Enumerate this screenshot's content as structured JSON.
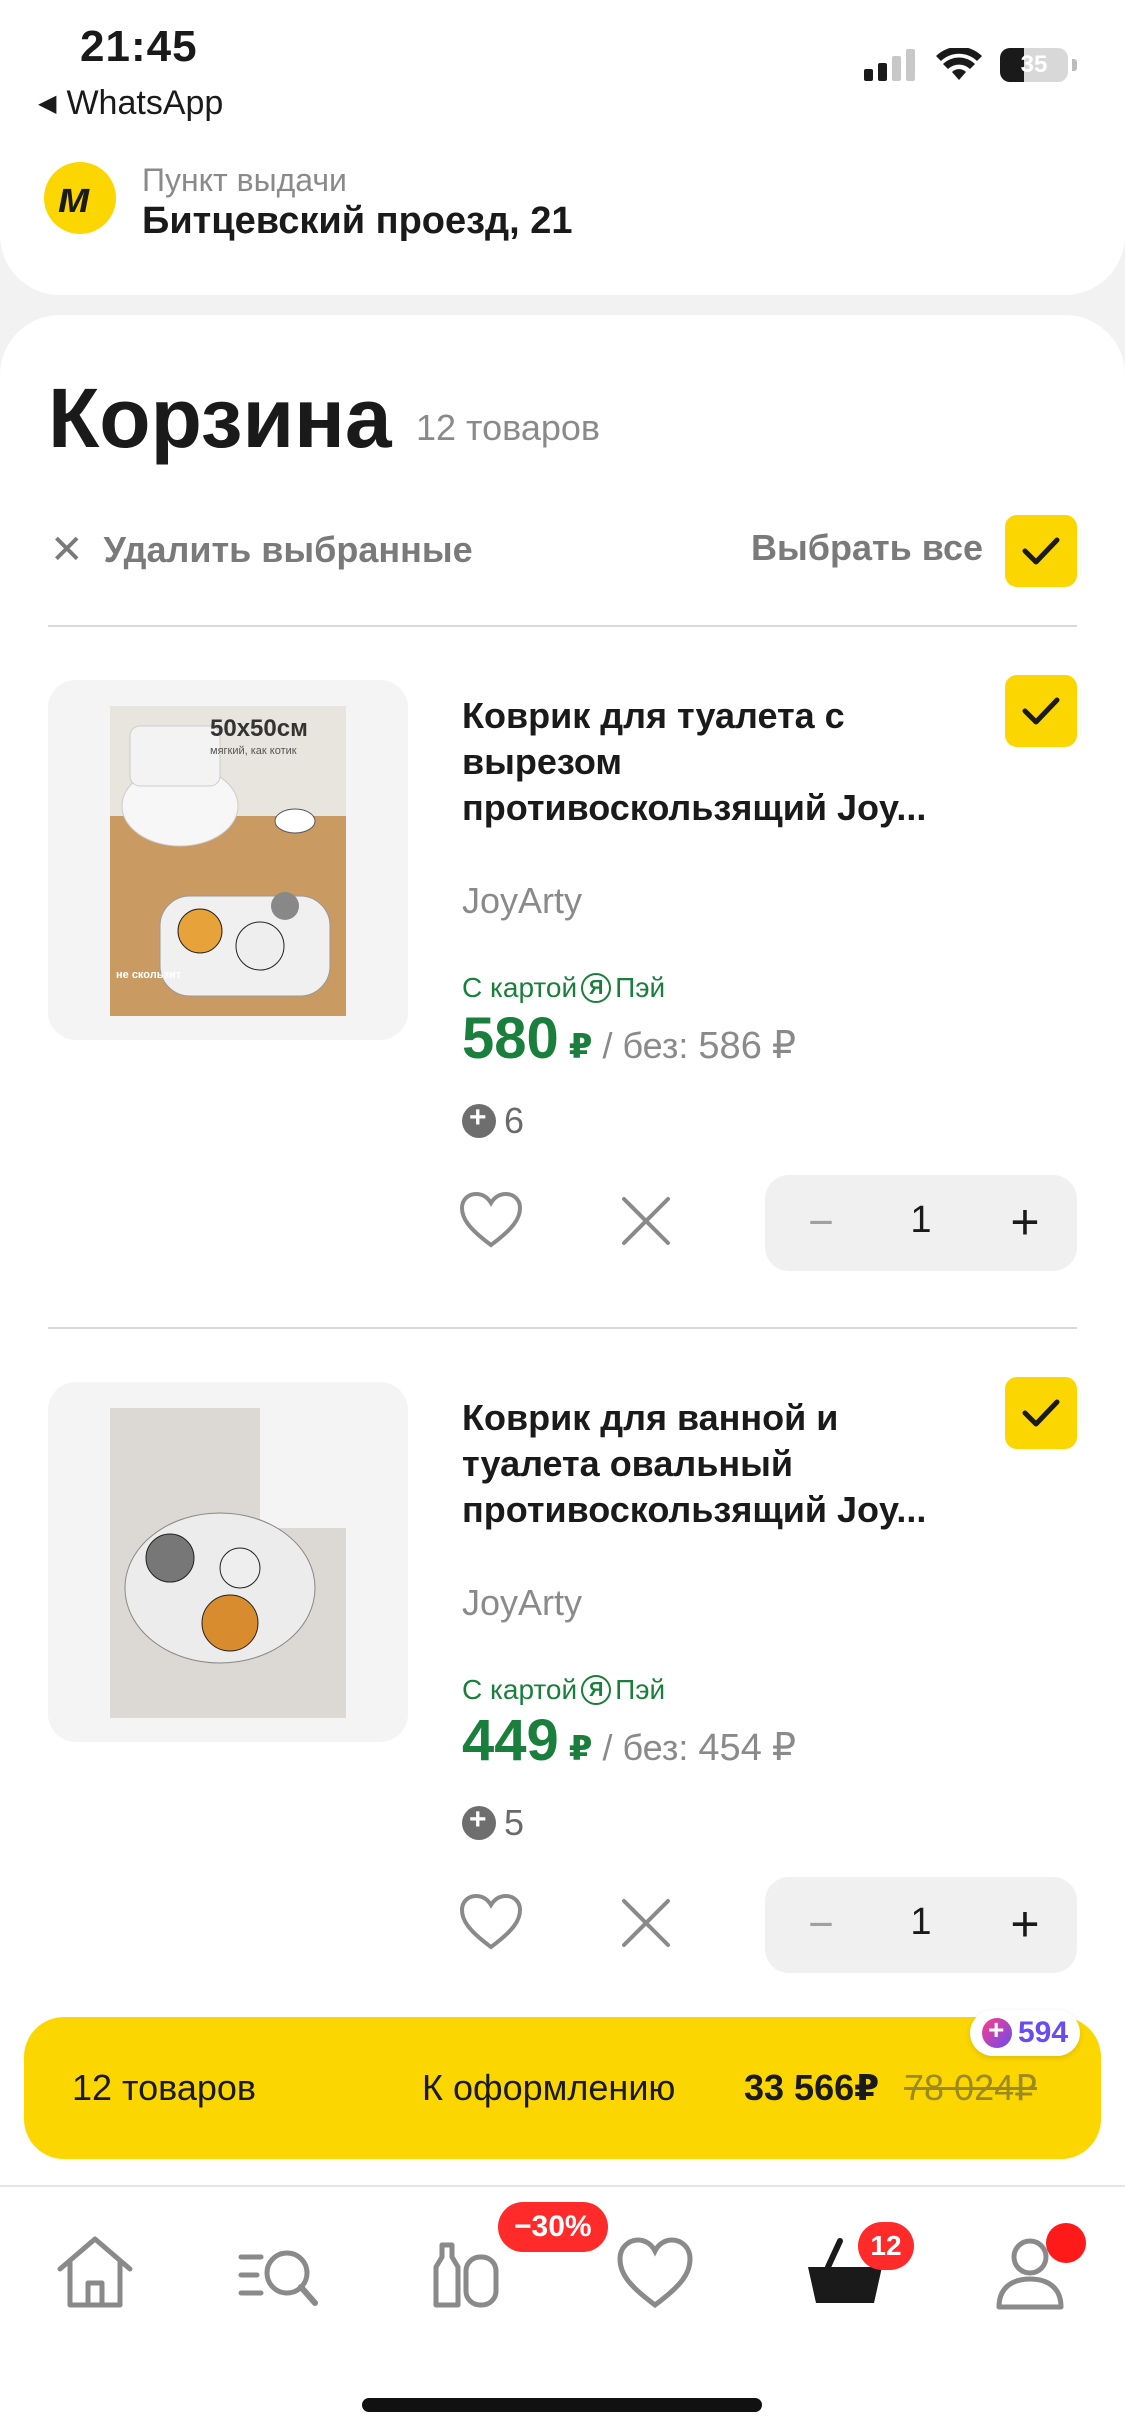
{
  "status_bar": {
    "time": "21:45",
    "back_app": "WhatsApp",
    "battery": "35",
    "battery_level": 0.35
  },
  "header": {
    "logo_letter": "м",
    "pickup_label": "Пункт выдачи",
    "pickup_address": "Битцевский проезд, 21"
  },
  "cart": {
    "title": "Корзина",
    "count": "12 товаров",
    "delete_selected": "Удалить выбранные",
    "select_all": "Выбрать все"
  },
  "products": [
    {
      "image_text_size": "50x50см",
      "image_text_sub": "мягкий, как котик",
      "image_text_nonslip": "не скользит",
      "title": "Коврик для туалета с вырезом противоскользящий Joy...",
      "brand": "JoyArty",
      "card_label_pre": "С картой",
      "card_label_ya": "Я",
      "card_label_post": "Пэй",
      "price": "580",
      "currency": "₽",
      "without_label": "/ без:",
      "price_without": "586",
      "points": "6",
      "quantity": "1",
      "minus": "−",
      "plus": "+"
    },
    {
      "title": "Коврик для ванной и туалета овальный противоскользящий Joy...",
      "brand": "JoyArty",
      "card_label_pre": "С картой",
      "card_label_ya": "Я",
      "card_label_post": "Пэй",
      "price": "449",
      "currency": "₽",
      "without_label": "/ без:",
      "price_without": "454",
      "points": "5",
      "quantity": "1",
      "minus": "−",
      "plus": "+"
    }
  ],
  "checkout": {
    "count": "12 товаров",
    "label": "К оформлению",
    "price": "33 566₽",
    "old_price": "78 024₽",
    "bonus": "594"
  },
  "tabbar": {
    "sale_badge": "−30%",
    "cart_badge": "12"
  },
  "colors": {
    "accent_yellow": "#fcd600",
    "price_green": "#1a7f3c",
    "badge_red": "#ff2a2a",
    "bonus_purple": "#6a4cf0"
  }
}
